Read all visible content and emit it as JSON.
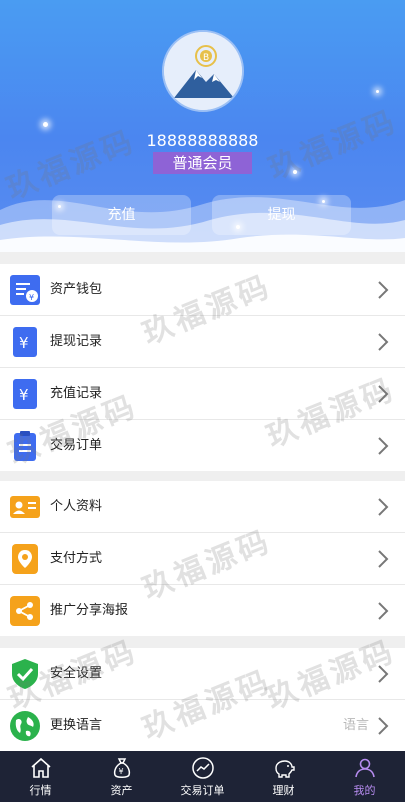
{
  "profile": {
    "phone": "18888888888",
    "level": "普通会员",
    "recharge_label": "充值",
    "withdraw_label": "提现"
  },
  "menu_groups": [
    {
      "items": [
        {
          "label": "资产钱包",
          "icon": "wallet-icon"
        },
        {
          "label": "提现记录",
          "icon": "yen-document-icon"
        },
        {
          "label": "充值记录",
          "icon": "yen-document-icon"
        },
        {
          "label": "交易订单",
          "icon": "order-icon"
        }
      ]
    },
    {
      "items": [
        {
          "label": "个人资料",
          "icon": "id-card-icon"
        },
        {
          "label": "支付方式",
          "icon": "location-pin-icon"
        },
        {
          "label": "推广分享海报",
          "icon": "share-icon"
        }
      ]
    },
    {
      "items": [
        {
          "label": "安全设置",
          "icon": "shield-check-icon"
        },
        {
          "label": "更换语言",
          "icon": "globe-icon",
          "value": "语言"
        }
      ]
    }
  ],
  "tabs": [
    {
      "label": "行情",
      "icon": "home-icon",
      "active": false
    },
    {
      "label": "资产",
      "icon": "money-bag-icon",
      "active": false
    },
    {
      "label": "交易订单",
      "icon": "chart-circle-icon",
      "active": false
    },
    {
      "label": "理财",
      "icon": "piggy-bank-icon",
      "active": false
    },
    {
      "label": "我的",
      "icon": "user-icon",
      "active": true
    }
  ],
  "watermark": "玖福源码",
  "colors": {
    "accent": "#4b86f0",
    "badge": "#8e63d6",
    "tabbar": "#1e2336",
    "active_tab": "#b78cf0"
  }
}
